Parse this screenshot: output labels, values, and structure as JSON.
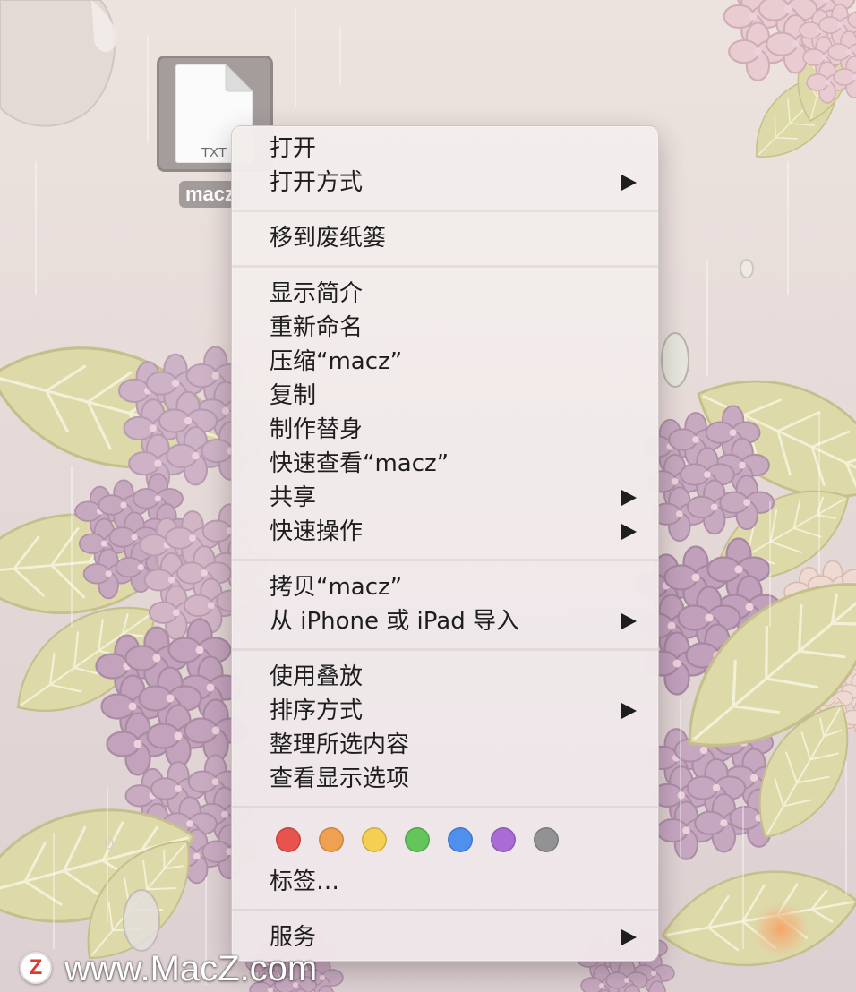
{
  "desktop": {
    "file": {
      "type_label": "TXT",
      "name": "macz",
      "icon": "text-document-icon"
    }
  },
  "context_menu": {
    "groups": [
      {
        "items": [
          {
            "label": "打开",
            "submenu": false
          },
          {
            "label": "打开方式",
            "submenu": true
          }
        ]
      },
      {
        "items": [
          {
            "label": "移到废纸篓",
            "submenu": false
          }
        ]
      },
      {
        "items": [
          {
            "label": "显示简介",
            "submenu": false
          },
          {
            "label": "重新命名",
            "submenu": false
          },
          {
            "label": "压缩“macz”",
            "submenu": false
          },
          {
            "label": "复制",
            "submenu": false
          },
          {
            "label": "制作替身",
            "submenu": false
          },
          {
            "label": "快速查看“macz”",
            "submenu": false
          },
          {
            "label": "共享",
            "submenu": true
          },
          {
            "label": "快速操作",
            "submenu": true
          }
        ]
      },
      {
        "items": [
          {
            "label": "拷贝“macz”",
            "submenu": false
          },
          {
            "label": "从 iPhone 或 iPad 导入",
            "submenu": true
          }
        ]
      },
      {
        "items": [
          {
            "label": "使用叠放",
            "submenu": false
          },
          {
            "label": "排序方式",
            "submenu": true
          },
          {
            "label": "整理所选内容",
            "submenu": false
          },
          {
            "label": "查看显示选项",
            "submenu": false
          }
        ]
      }
    ],
    "tags": {
      "colors": [
        "#e8534e",
        "#efa050",
        "#f4cf52",
        "#63c55a",
        "#4f8fee",
        "#a86cd4",
        "#929295"
      ],
      "label": "标签…"
    },
    "services": {
      "label": "服务",
      "submenu": true
    },
    "submenu_icon": "triangle-right-icon"
  },
  "watermark": {
    "logo_letter": "Z",
    "text": "www.MacZ.com"
  },
  "colors": {
    "menu_text": "#1e1e1e",
    "selection_highlight": "#a39c9a"
  }
}
